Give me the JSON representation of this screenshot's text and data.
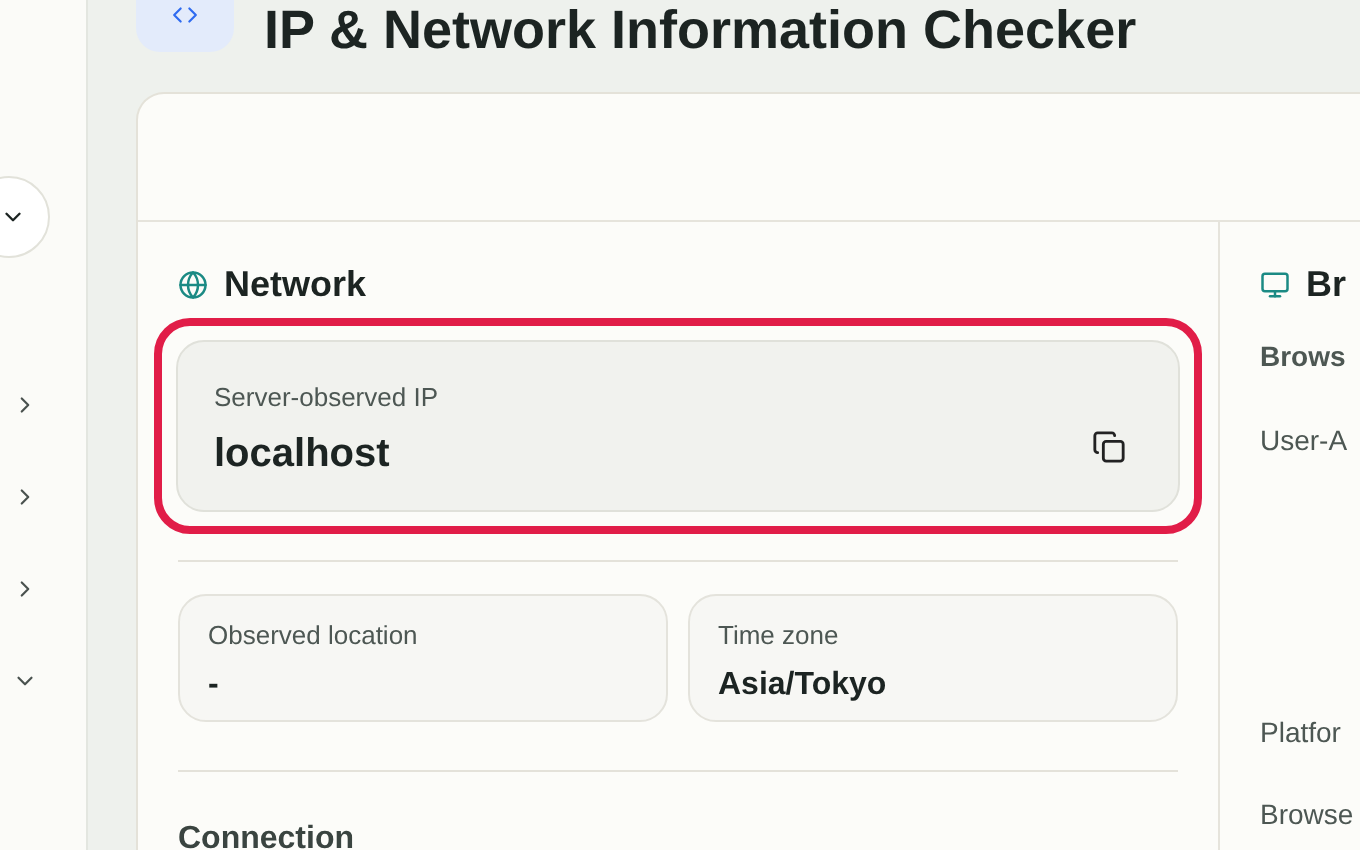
{
  "title": "IP & Network Information Checker",
  "sidebar": {
    "toggles": [
      {
        "expanded": false
      },
      {
        "expanded": false
      },
      {
        "expanded": false
      },
      {
        "expanded": true
      }
    ]
  },
  "network": {
    "heading": "Network",
    "ip": {
      "label": "Server-observed IP",
      "value": "localhost",
      "highlighted": true
    },
    "details": [
      {
        "label": "Observed location",
        "value": "-"
      },
      {
        "label": "Time zone",
        "value": "Asia/Tokyo"
      }
    ],
    "connection_heading": "Connection"
  },
  "browser": {
    "heading": "Br",
    "subheading": "Brows",
    "rows": [
      "User-A",
      "Platfor",
      "Browse"
    ]
  }
}
